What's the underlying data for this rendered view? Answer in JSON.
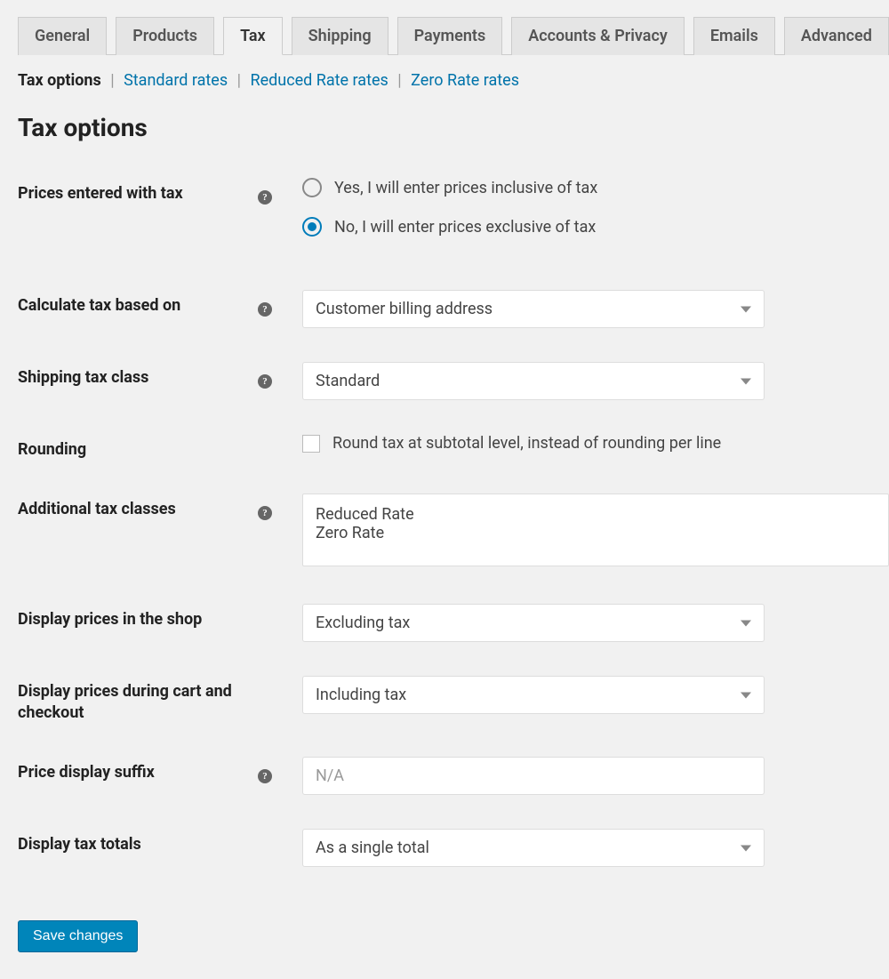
{
  "tabs": [
    {
      "label": "General",
      "active": false
    },
    {
      "label": "Products",
      "active": false
    },
    {
      "label": "Tax",
      "active": true
    },
    {
      "label": "Shipping",
      "active": false
    },
    {
      "label": "Payments",
      "active": false
    },
    {
      "label": "Accounts & Privacy",
      "active": false
    },
    {
      "label": "Emails",
      "active": false
    },
    {
      "label": "Advanced",
      "active": false
    }
  ],
  "subnav": {
    "current": "Tax options",
    "links": [
      "Standard rates",
      "Reduced Rate rates",
      "Zero Rate rates"
    ]
  },
  "title": "Tax options",
  "fields": {
    "prices_with_tax": {
      "label": "Prices entered with tax",
      "option_yes": "Yes, I will enter prices inclusive of tax",
      "option_no": "No, I will enter prices exclusive of tax",
      "selected": "no"
    },
    "calc_based_on": {
      "label": "Calculate tax based on",
      "value": "Customer billing address"
    },
    "shipping_tax_class": {
      "label": "Shipping tax class",
      "value": "Standard"
    },
    "rounding": {
      "label": "Rounding",
      "option": "Round tax at subtotal level, instead of rounding per line",
      "checked": false
    },
    "additional_classes": {
      "label": "Additional tax classes",
      "value": "Reduced Rate\nZero Rate"
    },
    "display_shop": {
      "label": "Display prices in the shop",
      "value": "Excluding tax"
    },
    "display_cart": {
      "label": "Display prices during cart and checkout",
      "value": "Including tax"
    },
    "price_suffix": {
      "label": "Price display suffix",
      "placeholder": "N/A",
      "value": ""
    },
    "display_totals": {
      "label": "Display tax totals",
      "value": "As a single total"
    }
  },
  "save_label": "Save changes"
}
